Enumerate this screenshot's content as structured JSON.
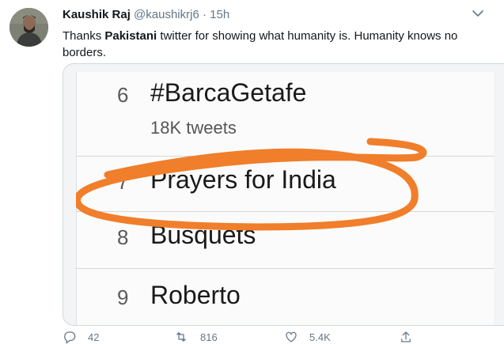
{
  "tweet": {
    "author_name": "Kaushik Raj",
    "handle": "@kaushikrj6",
    "separator": "·",
    "time": "15h",
    "text_prefix": "Thanks ",
    "text_bold": "Pakistani",
    "text_suffix": " twitter for showing what humanity is. Humanity knows no borders."
  },
  "trends": [
    {
      "rank": "6",
      "name": "#BarcaGetafe",
      "subtitle": "18K tweets"
    },
    {
      "rank": "7",
      "name": "Prayers for India",
      "subtitle": ""
    },
    {
      "rank": "8",
      "name": "Busquets",
      "subtitle": ""
    },
    {
      "rank": "9",
      "name": "Roberto",
      "subtitle": ""
    }
  ],
  "annotation": {
    "color": "#f07e2a"
  },
  "actions": {
    "replies": "42",
    "retweets": "816",
    "likes": "5.4K"
  },
  "colors": {
    "text": "#14171a",
    "secondary": "#657786",
    "border": "#cfd9de"
  }
}
